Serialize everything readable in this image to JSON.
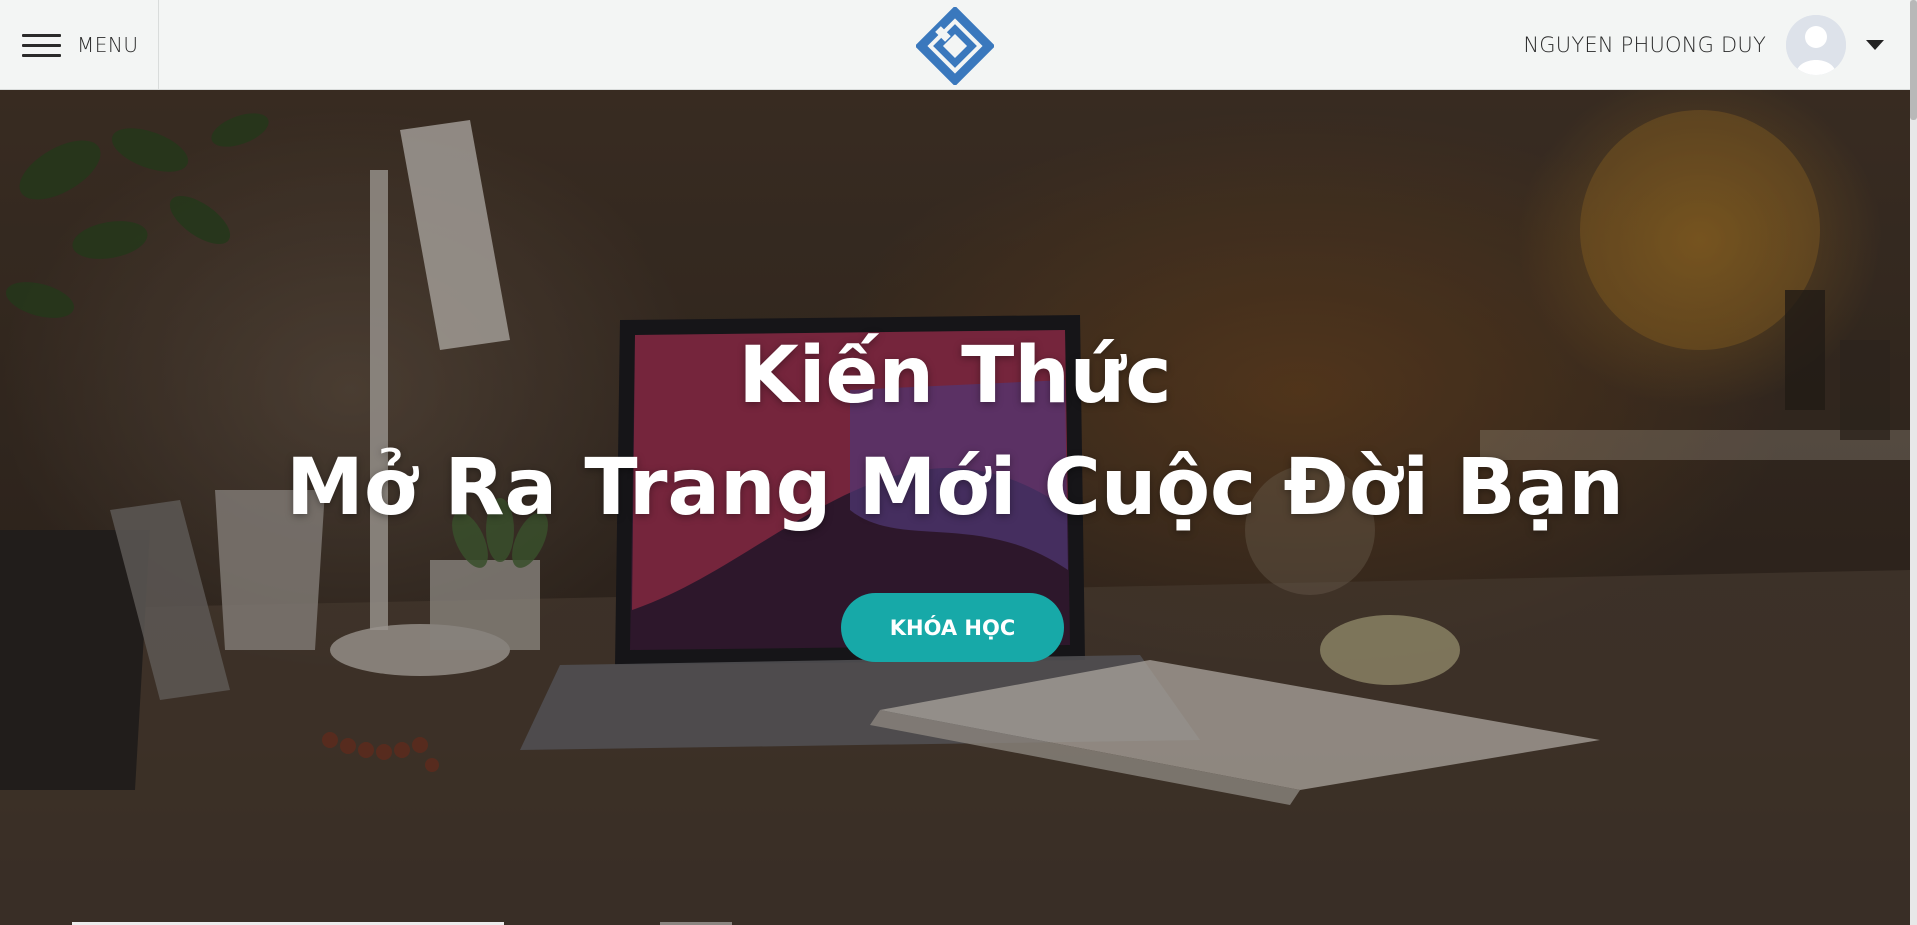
{
  "header": {
    "menu_label": "MENU",
    "user_name": "NGUYEN PHUONG DUY",
    "logo_icon": "diamond-logo-icon",
    "brand_color": "#3a78bd"
  },
  "hero": {
    "title_line1": "Kiến Thức",
    "title_line2": "Mở Ra Trang Mới Cuộc Đời Bạn",
    "cta_label": "KHÓA HỌC",
    "cta_color": "#17a9a8"
  }
}
